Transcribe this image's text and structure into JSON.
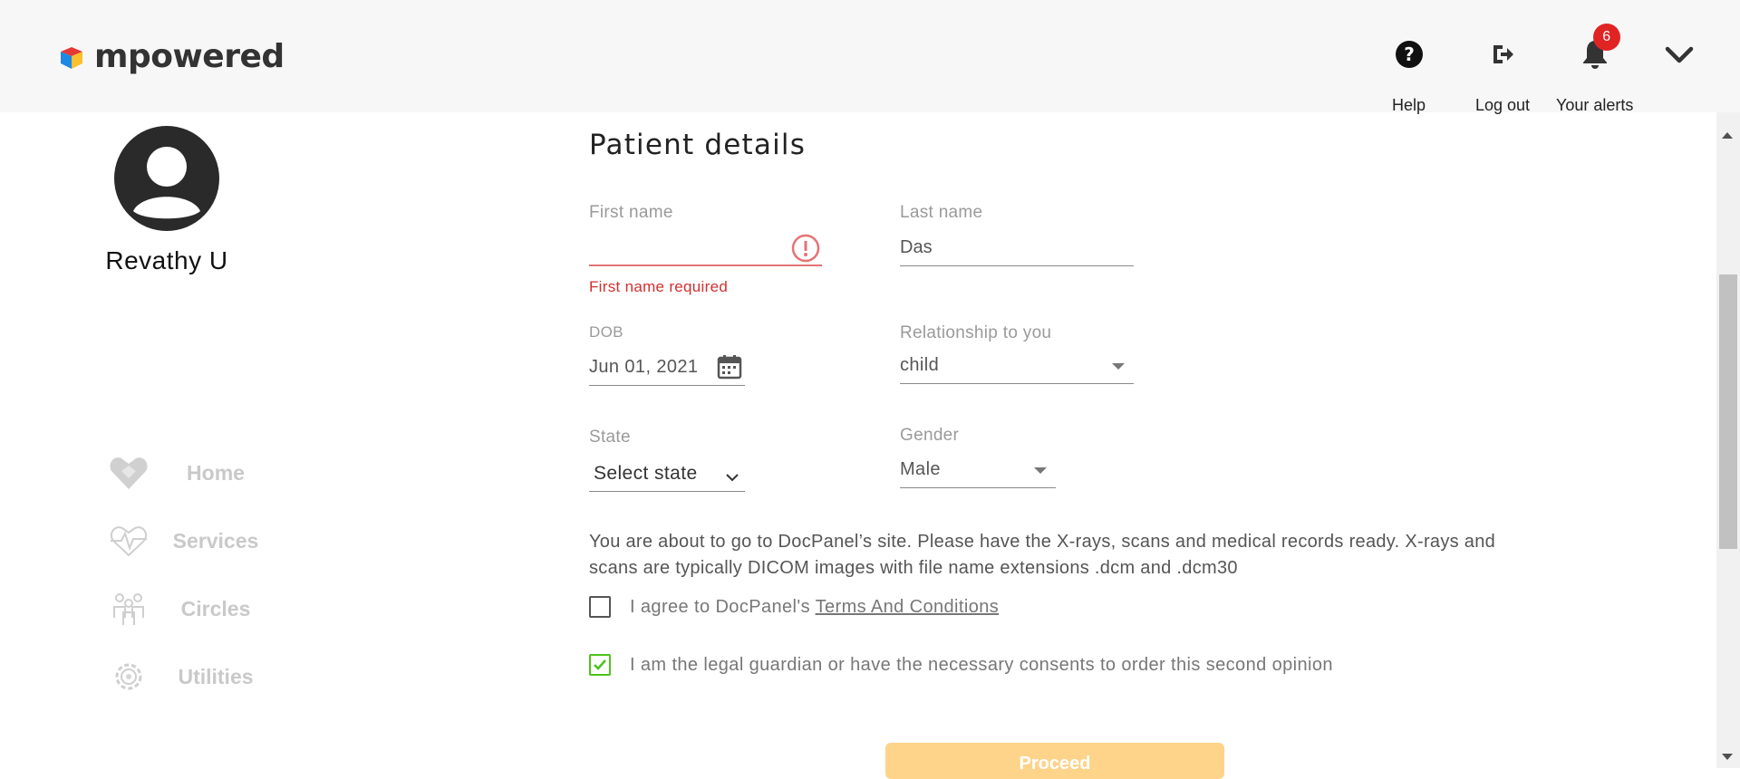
{
  "app": {
    "brand": "mpowered"
  },
  "header": {
    "help_label": "Help",
    "logout_label": "Log out",
    "alerts_label": "Your alerts",
    "alerts_count": "6",
    "icons": [
      "help-circle-icon",
      "logout-icon",
      "bell-icon",
      "chevron-down-icon"
    ]
  },
  "profile": {
    "name": "Revathy U"
  },
  "sidebar": {
    "items": [
      {
        "label": "Home",
        "icon": "heart-home-icon"
      },
      {
        "label": "Services",
        "icon": "heartbeat-icon"
      },
      {
        "label": "Circles",
        "icon": "people-icon"
      },
      {
        "label": "Utilities",
        "icon": "gear-icon"
      }
    ]
  },
  "form": {
    "title": "Patient details",
    "first_name": {
      "label": "First name",
      "value": "",
      "error": "First name required"
    },
    "last_name": {
      "label": "Last name",
      "value": "Das"
    },
    "dob": {
      "label": "DOB",
      "value": "Jun 01, 2021"
    },
    "relationship": {
      "label": "Relationship to you",
      "value": "child"
    },
    "state": {
      "label": "State",
      "value": "Select state"
    },
    "gender": {
      "label": "Gender",
      "value": "Male"
    },
    "info": "You are about to go to DocPanel’s site. Please have the X-rays, scans and medical records ready. X-rays and scans are typically DICOM images with file name extensions .dcm and .dcm30",
    "agree_prefix": "I agree to DocPanel's",
    "agree_link": "Terms And Conditions",
    "agree_checked": false,
    "guardian_label": "I am the legal guardian or have the necessary consents to order this second opinion",
    "guardian_checked": true,
    "proceed_label": "Proceed"
  },
  "colors": {
    "error": "#d32f2f",
    "check": "#4bc41b",
    "proceed_bg": "#fdd48a",
    "badge": "#e02424",
    "nav_disabled": "#c9c9c9"
  }
}
